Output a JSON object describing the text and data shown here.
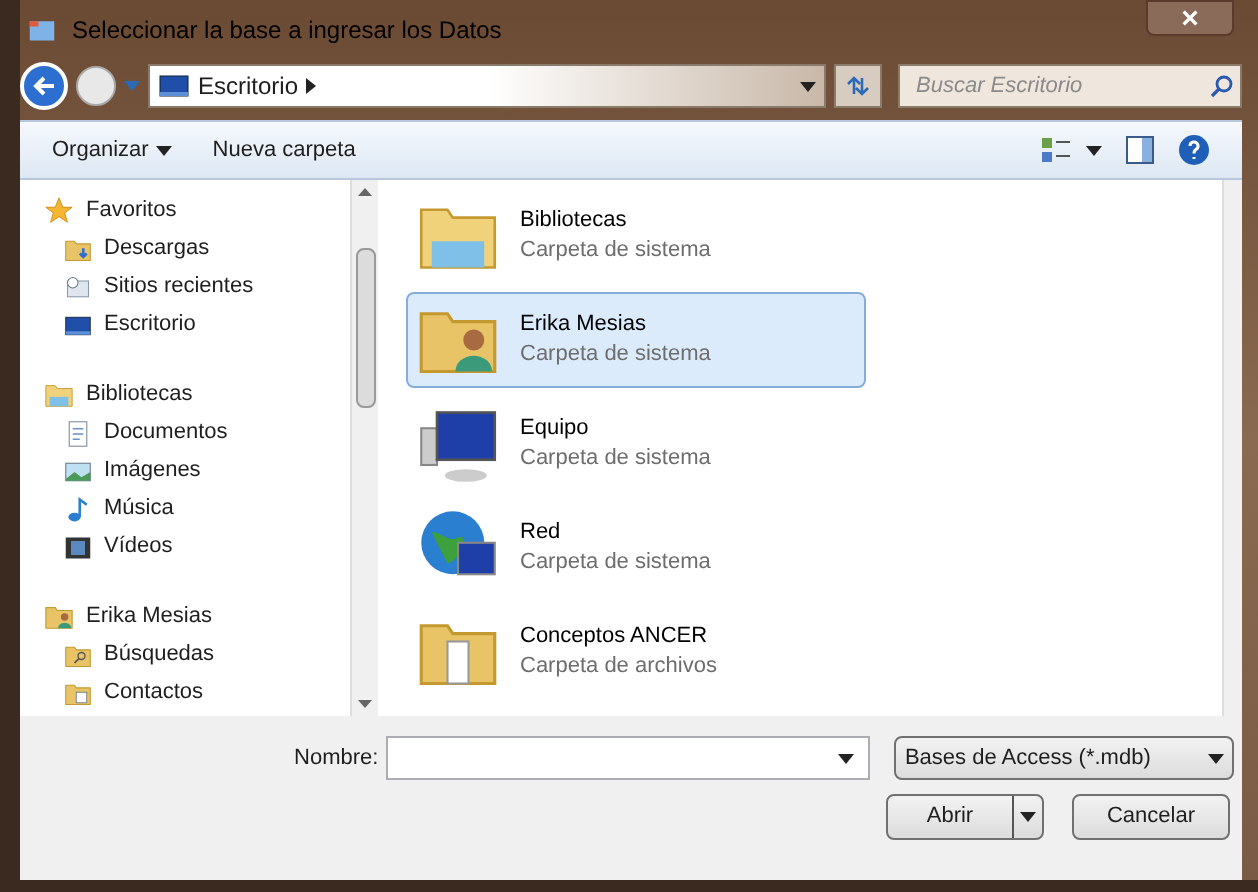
{
  "window": {
    "title": "Seleccionar la base a ingresar los Datos",
    "close": "×"
  },
  "address": {
    "crumbs": [
      "Escritorio"
    ],
    "search_placeholder": "Buscar Escritorio"
  },
  "toolbar": {
    "organize": "Organizar",
    "new_folder": "Nueva carpeta"
  },
  "sidebar": {
    "groups": [
      {
        "label": "Favoritos",
        "kind": "star",
        "children": [
          {
            "label": "Descargas",
            "kind": "download"
          },
          {
            "label": "Sitios recientes",
            "kind": "recent"
          },
          {
            "label": "Escritorio",
            "kind": "desktop"
          }
        ]
      },
      {
        "label": "Bibliotecas",
        "kind": "library",
        "children": [
          {
            "label": "Documentos",
            "kind": "document"
          },
          {
            "label": "Imágenes",
            "kind": "picture"
          },
          {
            "label": "Música",
            "kind": "music"
          },
          {
            "label": "Vídeos",
            "kind": "video"
          }
        ]
      },
      {
        "label": "Erika Mesias",
        "kind": "user",
        "children": [
          {
            "label": "Búsquedas",
            "kind": "search"
          },
          {
            "label": "Contactos",
            "kind": "contacts"
          }
        ]
      }
    ]
  },
  "items": [
    {
      "name": "Bibliotecas",
      "type": "Carpeta de sistema",
      "kind": "library",
      "selected": false
    },
    {
      "name": "Erika Mesias",
      "type": "Carpeta de sistema",
      "kind": "user",
      "selected": true
    },
    {
      "name": "Equipo",
      "type": "Carpeta de sistema",
      "kind": "computer",
      "selected": false
    },
    {
      "name": "Red",
      "type": "Carpeta de sistema",
      "kind": "network",
      "selected": false
    },
    {
      "name": "Conceptos ANCER",
      "type": "Carpeta de archivos",
      "kind": "folder",
      "selected": false
    }
  ],
  "footer": {
    "name_label": "Nombre:",
    "filter": "Bases de Access (*.mdb)",
    "open": "Abrir",
    "cancel": "Cancelar"
  }
}
